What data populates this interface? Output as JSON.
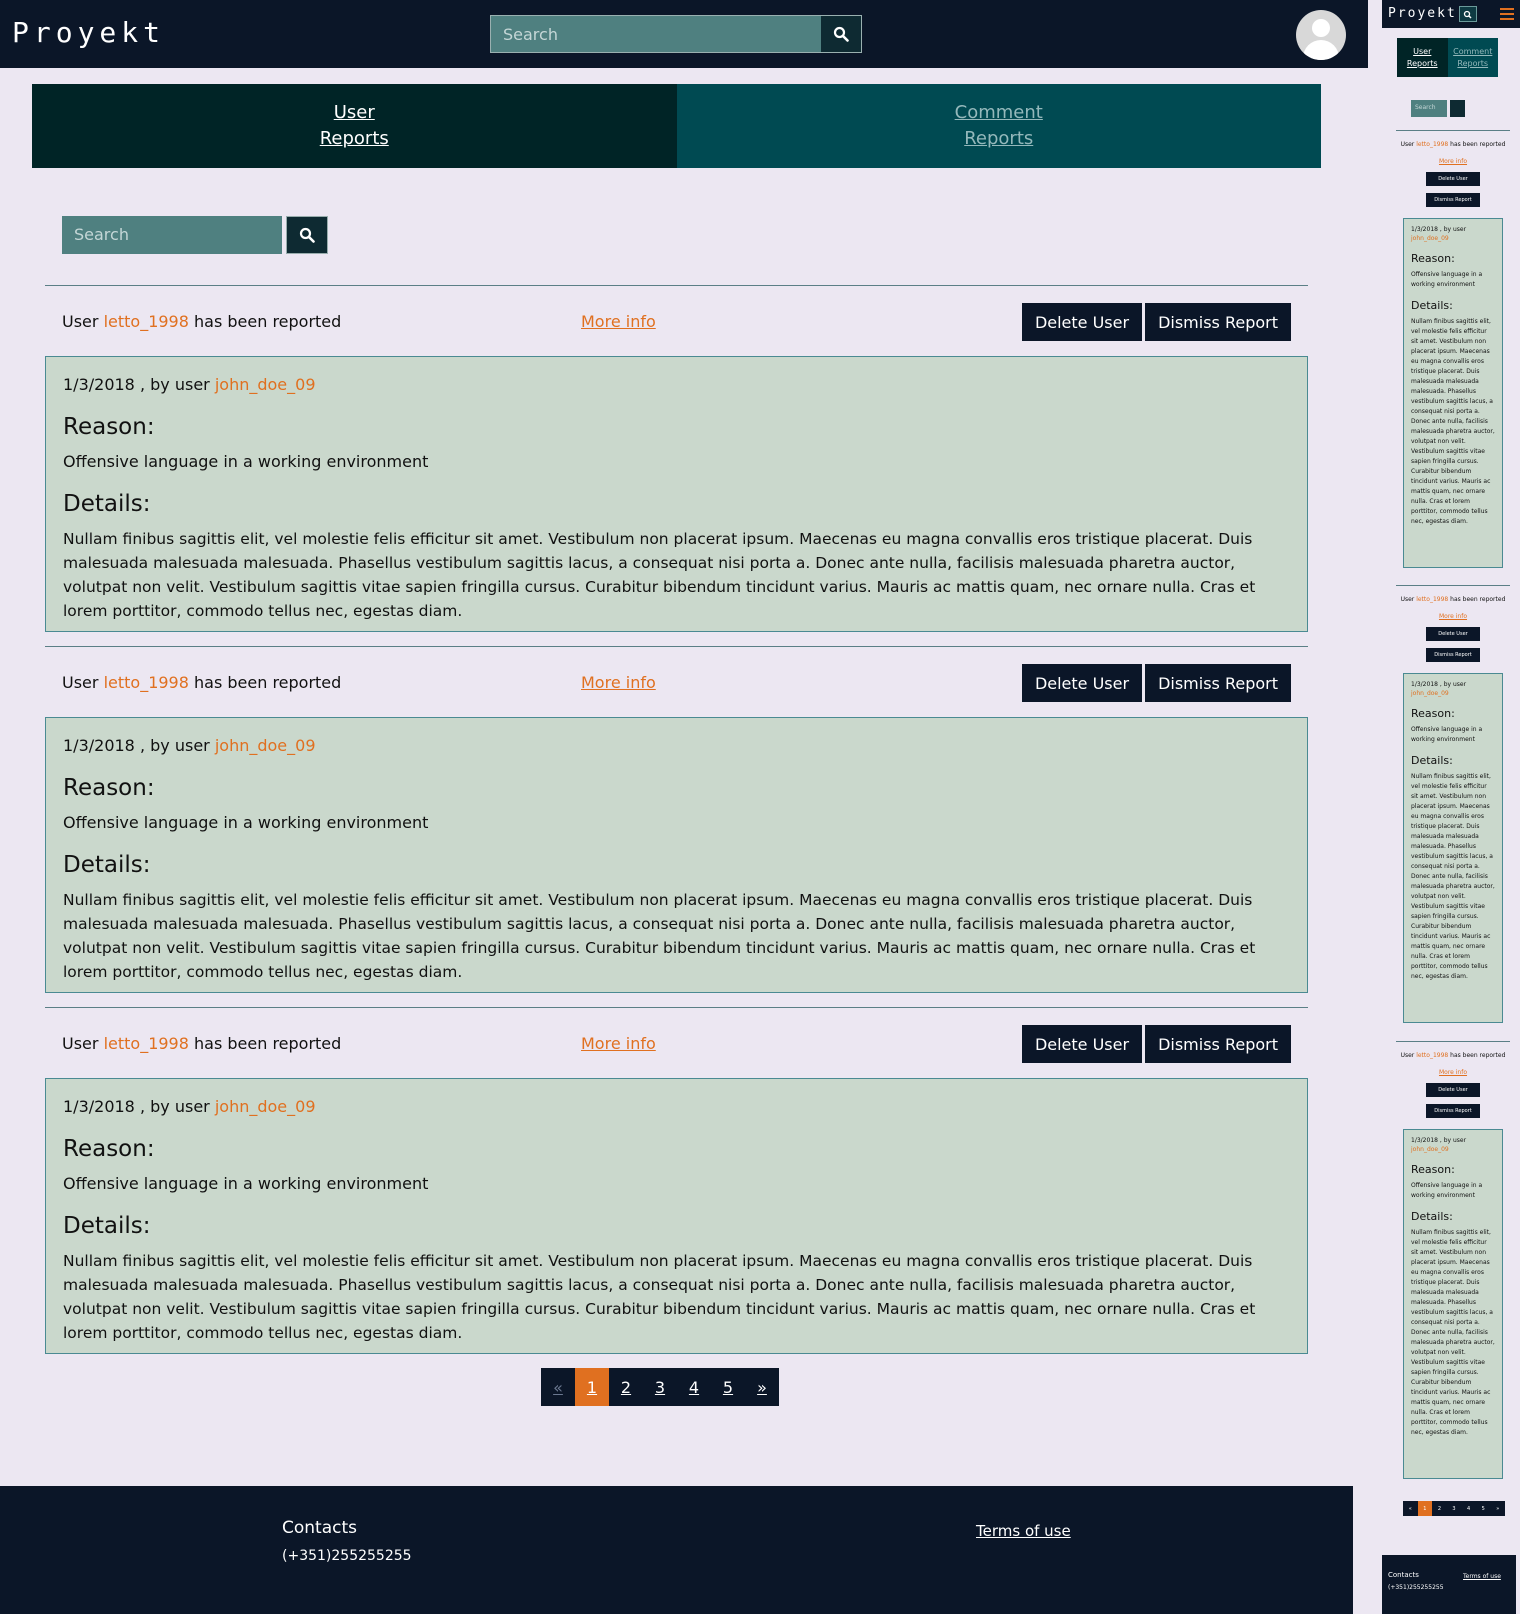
{
  "app": {
    "name": "Proyekt"
  },
  "header": {
    "search_placeholder": "Search"
  },
  "tabs": [
    {
      "line1": "User",
      "line2": "Reports",
      "active": true
    },
    {
      "line1": "Comment",
      "line2": "Reports",
      "active": false
    }
  ],
  "list_search": {
    "placeholder": "Search"
  },
  "reports": [
    {
      "prefix": "User",
      "user": "letto_1998",
      "suffix": "has been reported",
      "more": "More info",
      "delete": "Delete User",
      "dismiss": "Dismiss Report",
      "date": "1/3/2018",
      "by": ", by user",
      "reporter": "john_doe_09",
      "reason_heading": "Reason:",
      "reason": "Offensive language in a working environment",
      "details_heading": "Details:",
      "details": "Nullam finibus sagittis elit, vel molestie felis efficitur sit amet. Vestibulum non placerat ipsum. Maecenas eu magna convallis eros tristique placerat. Duis malesuada malesuada malesuada. Phasellus vestibulum sagittis lacus, a consequat nisi porta a. Donec ante nulla, facilisis malesuada pharetra auctor, volutpat non velit. Vestibulum sagittis vitae sapien fringilla cursus. Curabitur bibendum tincidunt varius. Mauris ac mattis quam, nec ornare nulla. Cras et lorem porttitor, commodo tellus nec, egestas diam."
    },
    {
      "prefix": "User",
      "user": "letto_1998",
      "suffix": "has been reported",
      "more": "More info",
      "delete": "Delete User",
      "dismiss": "Dismiss Report",
      "date": "1/3/2018",
      "by": ", by user",
      "reporter": "john_doe_09",
      "reason_heading": "Reason:",
      "reason": "Offensive language in a working environment",
      "details_heading": "Details:",
      "details": "Nullam finibus sagittis elit, vel molestie felis efficitur sit amet. Vestibulum non placerat ipsum. Maecenas eu magna convallis eros tristique placerat. Duis malesuada malesuada malesuada. Phasellus vestibulum sagittis lacus, a consequat nisi porta a. Donec ante nulla, facilisis malesuada pharetra auctor, volutpat non velit. Vestibulum sagittis vitae sapien fringilla cursus. Curabitur bibendum tincidunt varius. Mauris ac mattis quam, nec ornare nulla. Cras et lorem porttitor, commodo tellus nec, egestas diam."
    },
    {
      "prefix": "User",
      "user": "letto_1998",
      "suffix": "has been reported",
      "more": "More info",
      "delete": "Delete User",
      "dismiss": "Dismiss Report",
      "date": "1/3/2018",
      "by": ", by user",
      "reporter": "john_doe_09",
      "reason_heading": "Reason:",
      "reason": "Offensive language in a working environment",
      "details_heading": "Details:",
      "details": "Nullam finibus sagittis elit, vel molestie felis efficitur sit amet. Vestibulum non placerat ipsum. Maecenas eu magna convallis eros tristique placerat. Duis malesuada malesuada malesuada. Phasellus vestibulum sagittis lacus, a consequat nisi porta a. Donec ante nulla, facilisis malesuada pharetra auctor, volutpat non velit. Vestibulum sagittis vitae sapien fringilla cursus. Curabitur bibendum tincidunt varius. Mauris ac mattis quam, nec ornare nulla. Cras et lorem porttitor, commodo tellus nec, egestas diam."
    }
  ],
  "pagination": {
    "prev": "«",
    "pages": [
      "1",
      "2",
      "3",
      "4",
      "5"
    ],
    "current": "1",
    "next": "»"
  },
  "footer": {
    "contacts": "Contacts",
    "phone": "(+351)255255255",
    "terms": "Terms of use"
  },
  "colors": {
    "navy": "#0b1628",
    "teal": "#004a52",
    "accent": "#e07020",
    "card": "#cad8cc"
  },
  "icons": {
    "search": "search-icon",
    "avatar": "user-avatar-icon",
    "menu": "hamburger-menu-icon"
  }
}
